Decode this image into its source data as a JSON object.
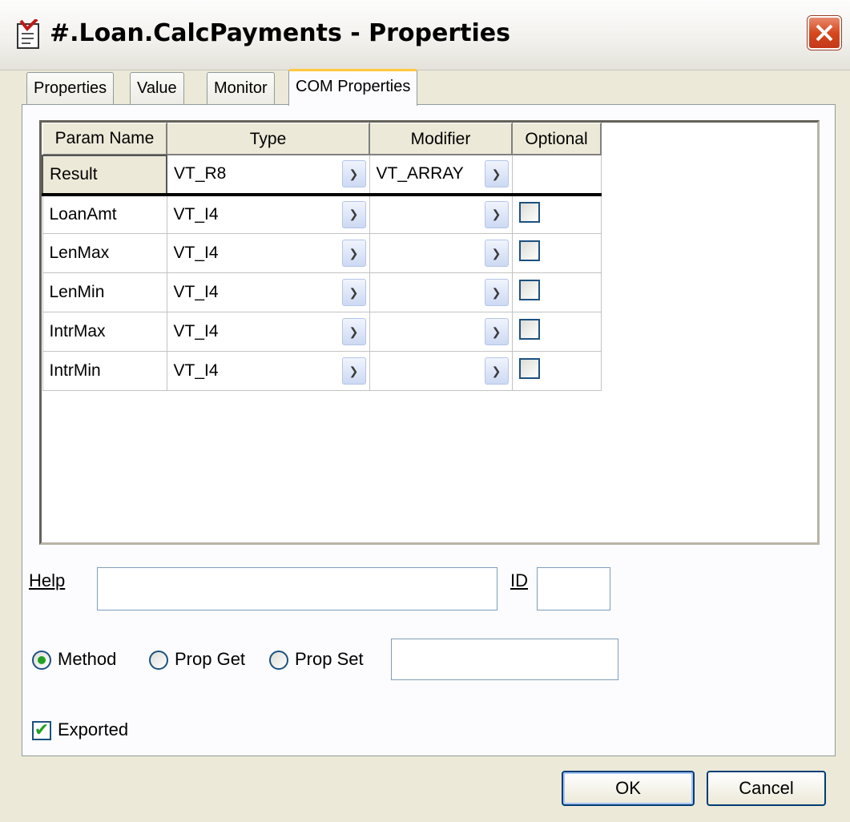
{
  "window": {
    "title": "#.Loan.CalcPayments - Properties"
  },
  "tabs": [
    {
      "label": "Properties",
      "active": false
    },
    {
      "label": "Value",
      "active": false
    },
    {
      "label": "Monitor",
      "active": false
    },
    {
      "label": "COM Properties",
      "active": true
    }
  ],
  "grid": {
    "headers": {
      "param_name": "Param Name",
      "type": "Type",
      "modifier": "Modifier",
      "optional": "Optional"
    },
    "rows": [
      {
        "name": "Result",
        "type": "VT_R8",
        "modifier": "VT_ARRAY",
        "optional": null
      },
      {
        "name": "LoanAmt",
        "type": "VT_I4",
        "modifier": "",
        "optional": false
      },
      {
        "name": "LenMax",
        "type": "VT_I4",
        "modifier": "",
        "optional": false
      },
      {
        "name": "LenMin",
        "type": "VT_I4",
        "modifier": "",
        "optional": false
      },
      {
        "name": "IntrMax",
        "type": "VT_I4",
        "modifier": "",
        "optional": false
      },
      {
        "name": "IntrMin",
        "type": "VT_I4",
        "modifier": "",
        "optional": false
      }
    ]
  },
  "form": {
    "help_label": "Help",
    "help_value": "",
    "id_label": "ID",
    "id_value": "",
    "radio_method": "Method",
    "radio_prop_get": "Prop Get",
    "radio_prop_set": "Prop Set",
    "selected_radio": "Method",
    "prop_value": "",
    "exported_label": "Exported",
    "exported_checked": true
  },
  "buttons": {
    "ok": "OK",
    "cancel": "Cancel"
  },
  "colors": {
    "dialog_bg": "#ece9d8",
    "close_button": "#d6491d",
    "active_tab_accent": "#ffc83c",
    "radio_check": "#21a121"
  }
}
